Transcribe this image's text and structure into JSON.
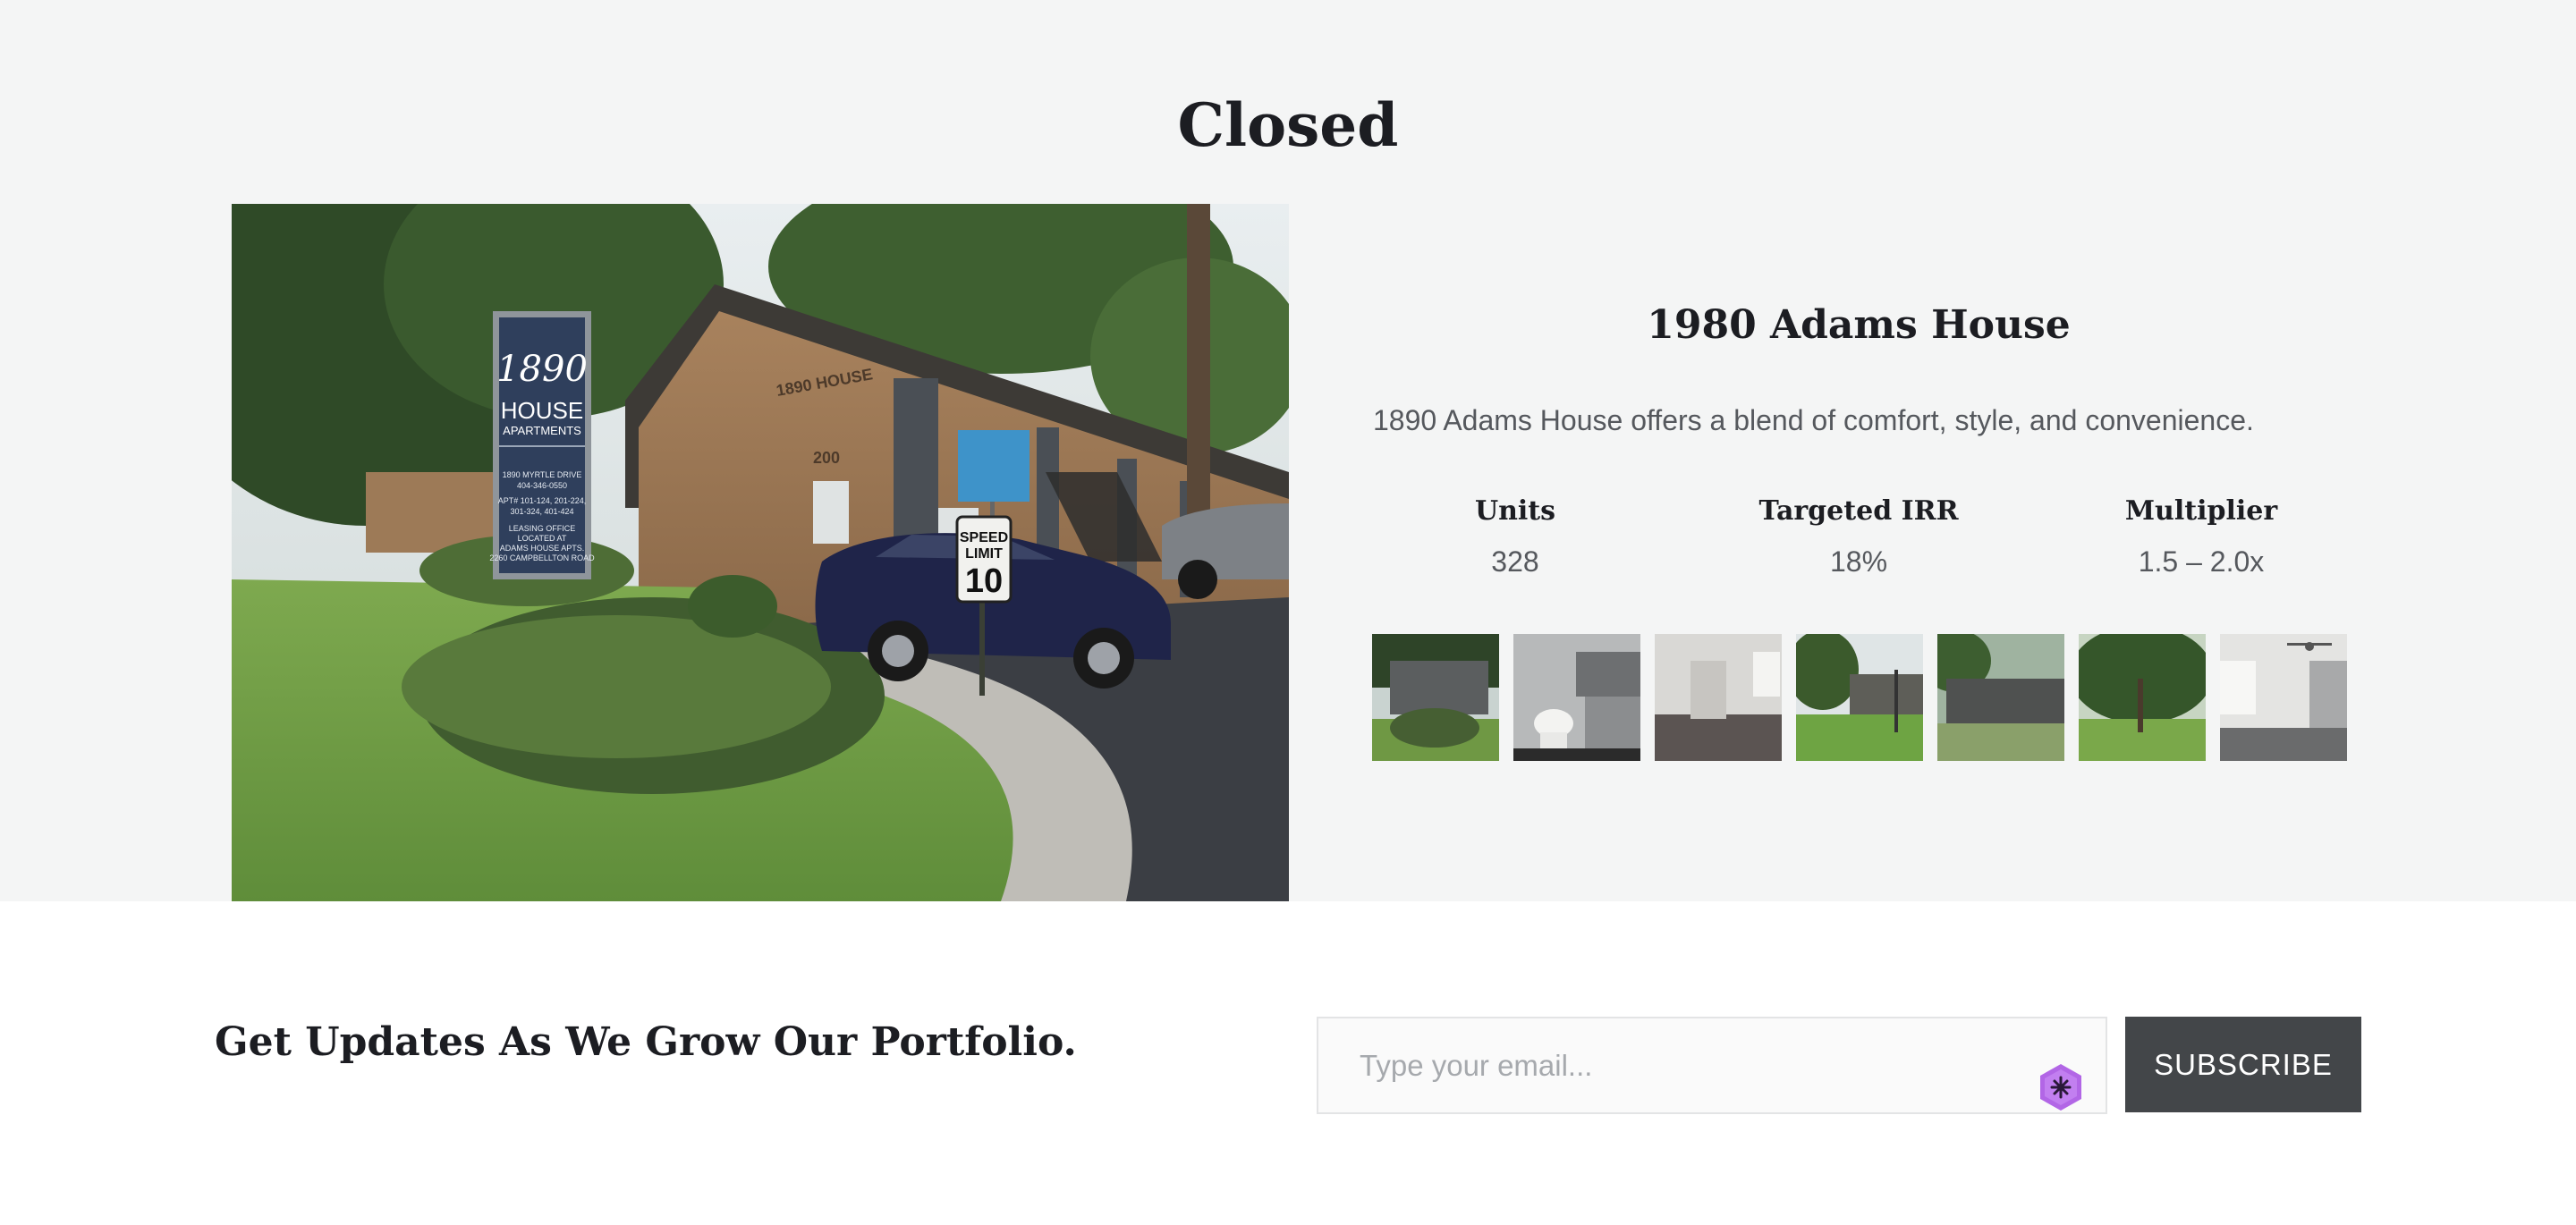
{
  "section": {
    "title": "Closed"
  },
  "property": {
    "name": "1980 Adams House",
    "description": "1890 Adams House offers a blend of comfort, style, and convenience.",
    "stats": [
      {
        "label": "Units",
        "value": "328"
      },
      {
        "label": "Targeted IRR",
        "value": "18%"
      },
      {
        "label": "Multiplier",
        "value": "1.5 – 2.0x"
      }
    ],
    "photo_sign": {
      "brand": "1890",
      "house": "HOUSE",
      "apartments": "APARTMENTS",
      "lines": [
        "1890 MYRTLE DRIVE",
        "404-346-0550",
        "APT# 101-124, 201-224,",
        "301-324, 401-424",
        "LEASING OFFICE",
        "LOCATED AT",
        "ADAMS HOUSE APTS.",
        "2260 CAMPBELLTON ROAD"
      ],
      "building_name": "1890 HOUSE",
      "building_number": "200",
      "speed_sign": [
        "SPEED",
        "LIMIT",
        "10"
      ]
    },
    "thumbnails": [
      {
        "name": "exterior-shrubs"
      },
      {
        "name": "bathroom"
      },
      {
        "name": "living-room"
      },
      {
        "name": "courtyard-lawn"
      },
      {
        "name": "building-row"
      },
      {
        "name": "trees-lawn"
      },
      {
        "name": "bedroom-fan"
      }
    ]
  },
  "newsletter": {
    "title": "Get Updates As We Grow Our Portfolio.",
    "email_placeholder": "Type your email...",
    "subscribe_label": "SUBSCRIBE"
  },
  "colors": {
    "section_background": "#f4f5f5",
    "button_background": "#434649",
    "heading_text": "#1c1d22",
    "body_text": "#55585d",
    "assist_icon": "#b266e6"
  }
}
